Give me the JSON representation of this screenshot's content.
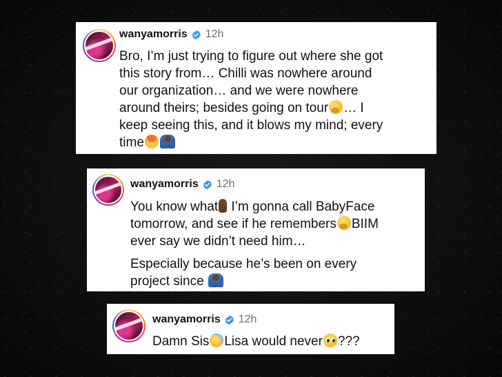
{
  "posts": [
    {
      "username": "wanyamorris",
      "time": "12h",
      "lines": [
        {
          "text": "Bro, I’m just trying to figure out where she got"
        },
        {
          "text": "this story from… Chilli was nowhere around"
        },
        {
          "text": "our organization… and we were nowhere"
        },
        {
          "text": "around theirs; besides going on tour",
          "emoji": "thinking-face-emoji",
          "after": "… I"
        },
        {
          "text": "keep seeing this, and it blows my mind; every"
        },
        {
          "text": "time",
          "emoji": "exploding-head-emoji",
          "emoji2": "shrug-emoji"
        }
      ]
    },
    {
      "username": "wanyamorris",
      "time": "12h",
      "lines": [
        {
          "text": "You know what",
          "emoji": "point-up-emoji",
          "after": "I’m gonna call BabyFace"
        },
        {
          "text": "tomorrow, and see if he remembers",
          "emoji": "thinking-face-emoji",
          "after": "BIIM"
        },
        {
          "text": "ever say we didn’t need him…"
        },
        {
          "text": "Especially because he’s been on every"
        },
        {
          "text": "project since",
          "emoji": "shrug-emoji"
        }
      ]
    },
    {
      "username": "wanyamorris",
      "time": "12h",
      "lines": [
        {
          "text": "Damn Sis",
          "emoji": "crying-face-emoji",
          "after": "Lisa would never",
          "emoji2": "pleading-face-emoji",
          "after2": "???"
        }
      ]
    }
  ],
  "colors": {
    "background": "#0d0d0d",
    "card": "#ffffff",
    "text": "#111111",
    "timestamp": "#6f6f6f",
    "verified": "#3897f0"
  }
}
